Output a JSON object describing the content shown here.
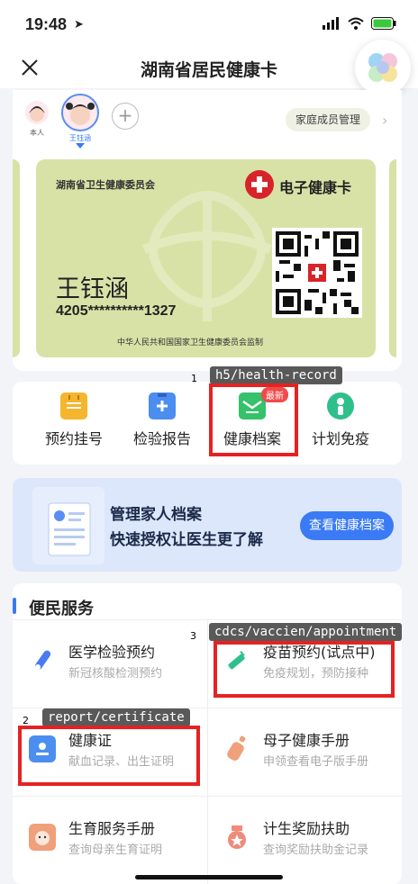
{
  "status": {
    "time": "19:48"
  },
  "nav": {
    "title": "湖南省居民健康卡"
  },
  "members": [
    {
      "label": "本人"
    },
    {
      "label": "王钰涵"
    }
  ],
  "family_button": "家庭成员管理",
  "card": {
    "issuer": "湖南省卫生健康委员会",
    "brand": "电子健康卡",
    "name": "王钰涵",
    "id_number": "4205**********1327",
    "supervisor": "中华人民共和国国家卫生健康委员会监制"
  },
  "quick_actions": [
    {
      "label": "预约挂号",
      "icon": "calendar-icon",
      "color": "#f5b52c"
    },
    {
      "label": "检验报告",
      "icon": "clipboard-plus-icon",
      "color": "#4b8ef0"
    },
    {
      "label": "健康档案",
      "icon": "mail-icon",
      "color": "#35c26b",
      "badge": "最新"
    },
    {
      "label": "计划免疫",
      "icon": "person-shield-icon",
      "color": "#2fbf8a"
    }
  ],
  "banner": {
    "line1": "管理家人档案",
    "line2": "快速授权让医生更了解",
    "button": "查看健康档案"
  },
  "services": {
    "title": "便民服务",
    "items": [
      {
        "name": "医学检验预约",
        "desc": "新冠核酸检测预约",
        "icon": "test-tube-icon",
        "color": "#4b7bf0"
      },
      {
        "name": "疫苗预约(试点中)",
        "desc": "免疫规划，预防接种",
        "icon": "syringe-icon",
        "color": "#2fbf8a"
      },
      {
        "name": "健康证",
        "desc": "献血记录、出生证明",
        "icon": "id-badge-icon",
        "color": "#4b8ef0"
      },
      {
        "name": "母子健康手册",
        "desc": "申领查看电子版手册",
        "icon": "baby-bottle-icon",
        "color": "#f0a07a"
      },
      {
        "name": "生育服务手册",
        "desc": "查询母亲生育证明",
        "icon": "baby-face-icon",
        "color": "#f0a07a"
      },
      {
        "name": "计生奖励扶助",
        "desc": "查询奖励扶助金记录",
        "icon": "medal-icon",
        "color": "#f08a7a"
      }
    ]
  },
  "overlays": [
    {
      "num": "1",
      "label": "h5/health-record"
    },
    {
      "num": "2",
      "label": "report/certificate"
    },
    {
      "num": "3",
      "label": "cdcs/vaccien/appointment"
    }
  ]
}
